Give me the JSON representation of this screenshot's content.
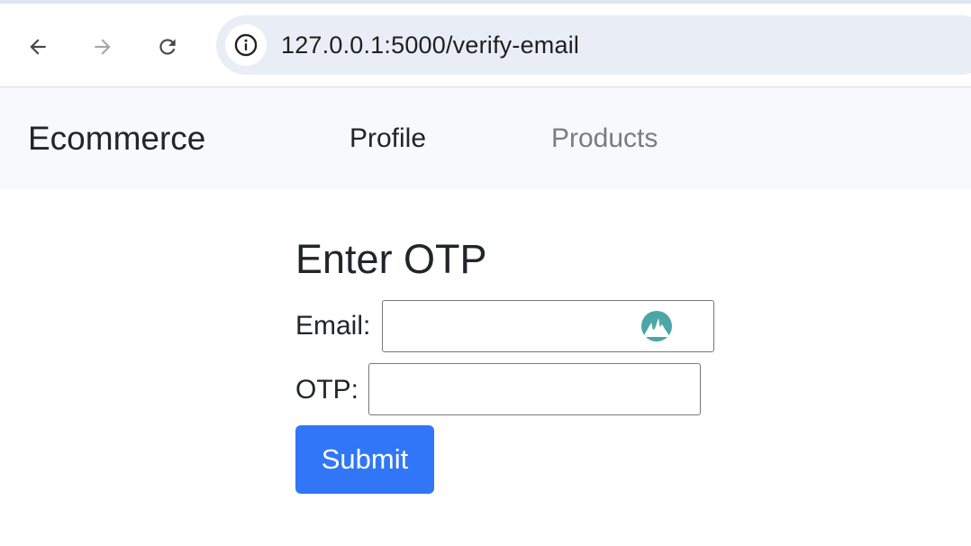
{
  "browser": {
    "url": "127.0.0.1:5000/verify-email",
    "icons": {
      "back": "arrow-left-icon",
      "forward": "arrow-right-icon",
      "reload": "reload-icon",
      "site_info": "info-icon"
    }
  },
  "navbar": {
    "brand": "Ecommerce",
    "links": [
      {
        "label": "Profile",
        "active": true
      },
      {
        "label": "Products",
        "active": false
      }
    ]
  },
  "main": {
    "title": "Enter OTP",
    "email_label": "Email:",
    "email_value": "",
    "otp_label": "OTP:",
    "otp_value": "",
    "submit_label": "Submit"
  },
  "colors": {
    "primary": "#3176f6",
    "navbar_bg": "#f8f9fa",
    "omnibox_bg": "#e9eef6",
    "extension_icon": "#4aa6a7"
  }
}
